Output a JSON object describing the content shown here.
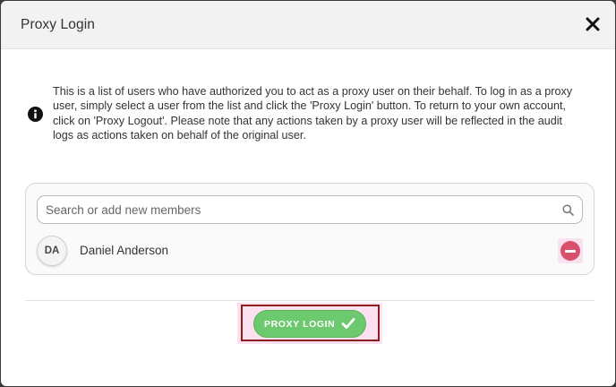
{
  "dialog": {
    "title": "Proxy Login",
    "close_icon": "close-icon"
  },
  "info": {
    "icon": "info-icon",
    "text": "This is a list of users who have authorized you to act as a proxy user on their behalf. To log in as a proxy user, simply select a user from the list and click the 'Proxy Login' button. To return to your own account, click on 'Proxy Logout'. Please note that any actions taken by a proxy user will be reflected in the audit logs as actions taken on behalf of the original user."
  },
  "members": {
    "search": {
      "value": "",
      "placeholder": "Search or add new members",
      "icon": "search-icon"
    },
    "list": [
      {
        "initials": "DA",
        "name": "Daniel Anderson",
        "remove_icon": "minus-circle-icon"
      }
    ]
  },
  "footer": {
    "proxy_login_label": "PROXY LOGIN",
    "proxy_login_icon": "check-icon"
  },
  "colors": {
    "accent_green": "#6cc96e",
    "remove_red": "#d9506d",
    "highlight_pink": "#fbe1ef",
    "highlight_border": "#8b1f1f"
  }
}
